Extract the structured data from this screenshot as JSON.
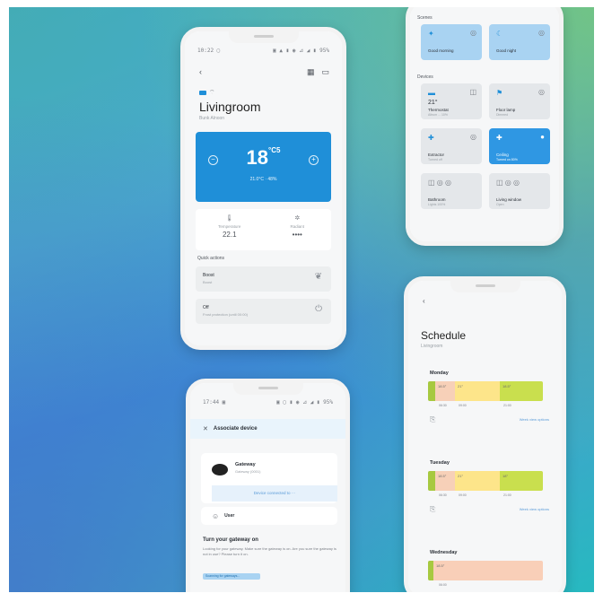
{
  "living": {
    "status_left": "10:22 ▢",
    "status_right": "▣ ▲ ▮ ◉ ⊿ ◢ ▮ 95%",
    "room_title": "Livingroom",
    "room_sub": "Bunk Alnoon",
    "setpoint": "18",
    "setpoint_decimal": "5",
    "setpoint_unit": "°C",
    "temp_caption": "21.0°C · 48%",
    "stats": [
      {
        "label": "Temperature",
        "value": "22.1"
      },
      {
        "label": "Radiant",
        "value": "••••"
      }
    ],
    "quick_actions_title": "Quick actions",
    "quick_actions": [
      {
        "title": "Boost",
        "sub": "Boost"
      },
      {
        "title": "Off",
        "sub": "Frost protection (until 00:00)"
      }
    ]
  },
  "scenes": {
    "scenes_label": "Scenes",
    "scene_tiles": [
      {
        "name": "Good morning",
        "sub": ""
      },
      {
        "name": "Good night",
        "sub": ""
      }
    ],
    "devices_label": "Devices",
    "device_tiles": [
      {
        "big": "21°",
        "name": "Thermostat",
        "sub": "Altrum ... 10%"
      },
      {
        "big": "",
        "name": "Floor lamp",
        "sub": "Dimmed"
      },
      {
        "big": "",
        "name": "Extractor",
        "sub": "Turned off"
      },
      {
        "big": "",
        "name": "Ceiling",
        "sub": "Turned on 80%"
      },
      {
        "big": "",
        "name": "Bathroom",
        "sub": "Lights 100%"
      },
      {
        "big": "",
        "name": "Living window",
        "sub": "Open"
      }
    ]
  },
  "assoc": {
    "status_left": "17:44 ▣",
    "status_right": "▣ ▢ ▮ ◉ ⊿ ◢ ▮ 95%",
    "header": "Associate device",
    "gateway_name": "Gateway",
    "gateway_sub": "Gateway (0001)",
    "gateway_action": "Device connected to ···",
    "user_label": "User",
    "turn_title": "Turn your gateway on",
    "turn_text": "Looking for your gateway. Make sure the gateway is on. Are you sure the gateway is not in use? Please turn it on.",
    "turn_badge": "Scanning for gateways..."
  },
  "schedule": {
    "title": "Schedule",
    "subtitle": "Livingroom",
    "days": [
      {
        "name": "Monday",
        "segments": [
          {
            "label": "",
            "color": "#a7c940",
            "width": 8
          },
          {
            "label": "18.5°",
            "color": "#f7d0b8",
            "width": 22
          },
          {
            "label": "21°",
            "color": "#fde58a",
            "width": 50
          },
          {
            "label": "18.5°",
            "color": "#c9df4e",
            "width": 48
          }
        ],
        "times": [
          "06:30",
          "09:00",
          "21:00"
        ],
        "link": "Week view options"
      },
      {
        "name": "Tuesday",
        "segments": [
          {
            "label": "",
            "color": "#a7c940",
            "width": 8
          },
          {
            "label": "18.5°",
            "color": "#f7d0b8",
            "width": 22
          },
          {
            "label": "21°",
            "color": "#fde58a",
            "width": 50
          },
          {
            "label": "18°",
            "color": "#c9df4e",
            "width": 48
          }
        ],
        "times": [
          "06:30",
          "09:00",
          "21:00"
        ],
        "link": "Week view options"
      },
      {
        "name": "Wednesday",
        "segments": [
          {
            "label": "",
            "color": "#a7c940",
            "width": 6
          },
          {
            "label": "18.5°",
            "color": "#f9cfb8",
            "width": 122
          }
        ],
        "times": [
          "06:00"
        ],
        "link": ""
      }
    ]
  },
  "colors": {
    "accent": "#1f8fd8",
    "tile_active": "#2f97e3",
    "tile_light": "#a9d3f2"
  },
  "icons": {
    "back": "chevron-left-icon",
    "grid": "grid-icon",
    "calendar": "calendar-icon",
    "thermo": "thermometer-icon",
    "sun": "sun-icon",
    "plant": "plant-icon",
    "power": "power-icon"
  }
}
